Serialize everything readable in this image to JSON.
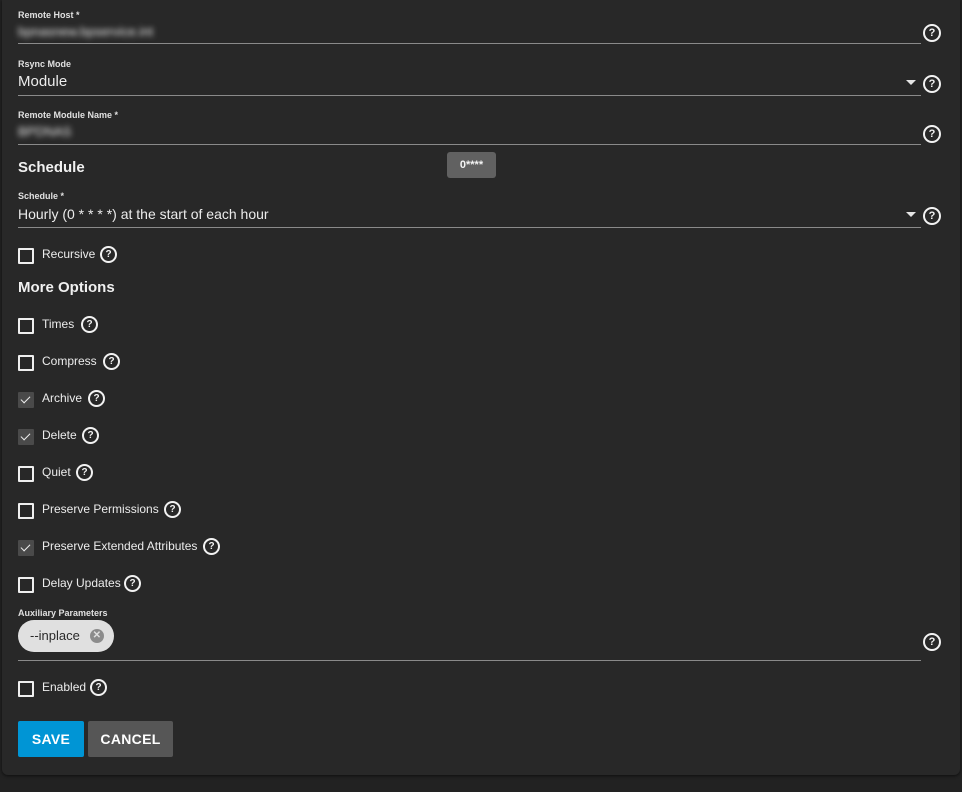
{
  "remote_host": {
    "label": "Remote Host *",
    "value": "bpnasnew.bpservice.int"
  },
  "rsync_mode": {
    "label": "Rsync Mode",
    "value": "Module"
  },
  "remote_module": {
    "label": "Remote Module Name *",
    "value": "BPDNAS"
  },
  "schedule_section": {
    "title": "Schedule",
    "tooltip": "0****"
  },
  "schedule": {
    "label": "Schedule *",
    "value": "Hourly (0 * * * *) at the start of each hour"
  },
  "recursive": {
    "label": "Recursive",
    "checked": false
  },
  "more_options": {
    "title": "More Options",
    "options": [
      {
        "label": "Times",
        "checked": false
      },
      {
        "label": "Compress",
        "checked": false
      },
      {
        "label": "Archive",
        "checked": true
      },
      {
        "label": "Delete",
        "checked": true
      },
      {
        "label": "Quiet",
        "checked": false
      },
      {
        "label": "Preserve Permissions",
        "checked": false
      },
      {
        "label": "Preserve Extended Attributes",
        "checked": true
      },
      {
        "label": "Delay Updates",
        "checked": false
      }
    ]
  },
  "auxiliary": {
    "label": "Auxiliary Parameters",
    "chips": [
      "--inplace"
    ]
  },
  "enabled": {
    "label": "Enabled",
    "checked": false
  },
  "buttons": {
    "save": "SAVE",
    "cancel": "CANCEL"
  },
  "icons": {
    "help": "help-circle-icon",
    "dropdown": "caret-down-icon",
    "chip_remove": "close-circle-icon",
    "checkbox": "checkbox-icon"
  },
  "colors": {
    "background": "#282828",
    "primary": "#0095d5",
    "cancel": "#565656",
    "chip": "#e0e0e0"
  }
}
